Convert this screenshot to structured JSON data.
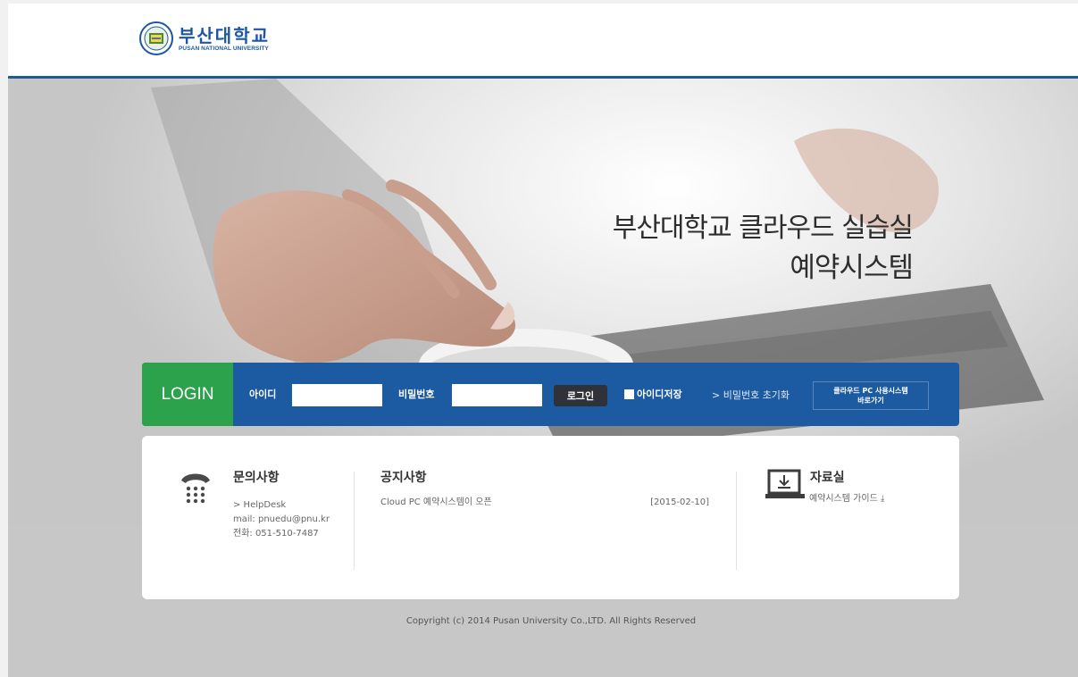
{
  "header": {
    "logo_ko": "부산대학교",
    "logo_en": "PUSAN NATIONAL UNIVERSITY"
  },
  "hero": {
    "line1": "부산대학교 클라우드 실습실",
    "line2": "예약시스템"
  },
  "login": {
    "tab_label": "LOGIN",
    "id_label": "아이디",
    "id_value": "",
    "pw_label": "비밀번호",
    "pw_value": "",
    "login_button": "로그인",
    "remember_label": "아이디저장",
    "reset_link": "> 비밀번호 초기화",
    "cloud_button_line1": "클라우드 PC 사용시스템",
    "cloud_button_line2": "바로가기"
  },
  "contact": {
    "title": "문의사항",
    "helpdesk": "> HelpDesk",
    "mail": "mail: pnuedu@pnu.kr",
    "phone": "전화: 051-510-7487"
  },
  "notice": {
    "title": "공지사항",
    "items": [
      {
        "title": "Cloud PC 예약시스템이 오픈",
        "date": "[2015-02-10]"
      }
    ]
  },
  "archive": {
    "title": "자료실",
    "guide": "예약시스템 가이드"
  },
  "footer": {
    "copyright": "Copyright (c) 2014 Pusan University Co.,LTD. All Rights Reserved"
  },
  "colors": {
    "brand_blue": "#1c5aa1",
    "login_green": "#2ba24b"
  }
}
